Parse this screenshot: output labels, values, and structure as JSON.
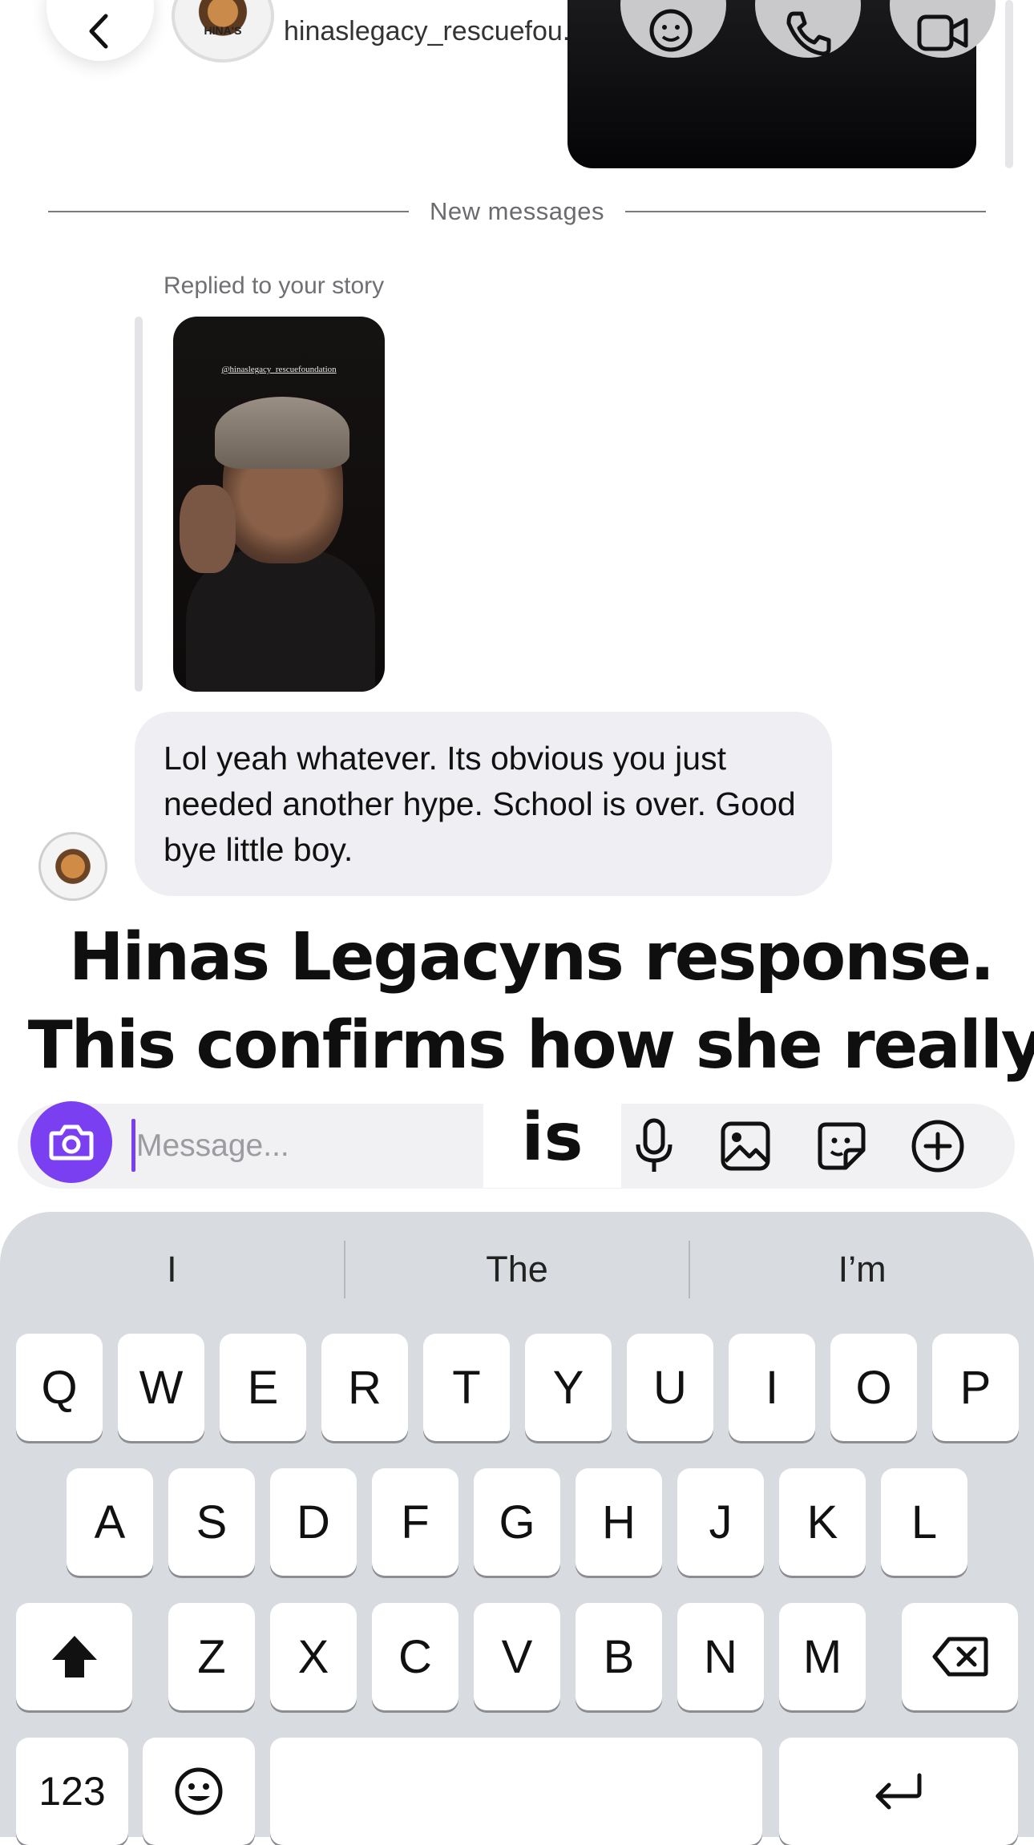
{
  "header": {
    "username": "hinaslegacy_rescuefou...",
    "avatar_seal_text": "HINA'S"
  },
  "divider": {
    "label": "New messages"
  },
  "story_reply": {
    "label": "Replied to your story",
    "story_handle": "@hinaslegacy_rescuefoundation"
  },
  "message": {
    "text": "Lol yeah whatever. Its obvious you just needed another hype. School is over. Good bye little boy."
  },
  "caption": {
    "line1": "Hinas Legacyns response.",
    "line2": "This confirms how she really",
    "line3": "is"
  },
  "composer": {
    "placeholder": "Message..."
  },
  "keyboard": {
    "suggestions": [
      "I",
      "The",
      "I’m"
    ],
    "row1": [
      "Q",
      "W",
      "E",
      "R",
      "T",
      "Y",
      "U",
      "I",
      "O",
      "P"
    ],
    "row2": [
      "A",
      "S",
      "D",
      "F",
      "G",
      "H",
      "J",
      "K",
      "L"
    ],
    "row3": [
      "Z",
      "X",
      "C",
      "V",
      "B",
      "N",
      "M"
    ],
    "numbers_label": "123"
  },
  "colors": {
    "accent": "#7b3ff2",
    "bubble": "#efeff3",
    "keyboard_bg": "#d8dbe0"
  }
}
